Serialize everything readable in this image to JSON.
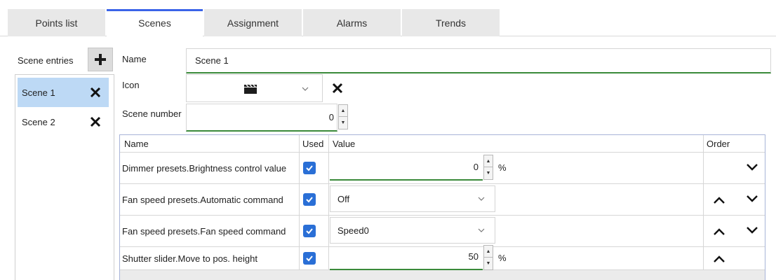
{
  "tabs": [
    {
      "label": "Points list"
    },
    {
      "label": "Scenes"
    },
    {
      "label": "Assignment"
    },
    {
      "label": "Alarms"
    },
    {
      "label": "Trends"
    }
  ],
  "sidebar": {
    "title": "Scene entries",
    "add_icon": "plus-icon",
    "items": [
      {
        "label": "Scene 1",
        "selected": true
      },
      {
        "label": "Scene 2",
        "selected": false
      }
    ]
  },
  "form": {
    "name_label": "Name",
    "name_value": "Scene 1",
    "icon_label": "Icon",
    "icon_value": "clapperboard-icon",
    "scene_number_label": "Scene number",
    "scene_number_value": "0"
  },
  "table": {
    "headers": {
      "name": "Name",
      "used": "Used",
      "value": "Value",
      "order": "Order"
    },
    "rows": [
      {
        "name": "Dimmer presets.Brightness control value",
        "used": true,
        "value": "0",
        "unit": "%",
        "kind": "number",
        "order": [
          "down"
        ]
      },
      {
        "name": "Fan speed presets.Automatic command",
        "used": true,
        "value": "Off",
        "kind": "select",
        "order": [
          "up",
          "down"
        ]
      },
      {
        "name": "Fan speed presets.Fan speed command",
        "used": true,
        "value": "Speed0",
        "kind": "select",
        "order": [
          "up",
          "down"
        ]
      },
      {
        "name": "Shutter slider.Move to pos. height",
        "used": true,
        "value": "50",
        "unit": "%",
        "kind": "number",
        "order": [
          "up"
        ]
      }
    ]
  },
  "colors": {
    "accent": "#3b64e8",
    "selected_row": "#bdd9f5",
    "checkbox": "#2a6fd6",
    "focus_underline": "#3a8a3a"
  }
}
